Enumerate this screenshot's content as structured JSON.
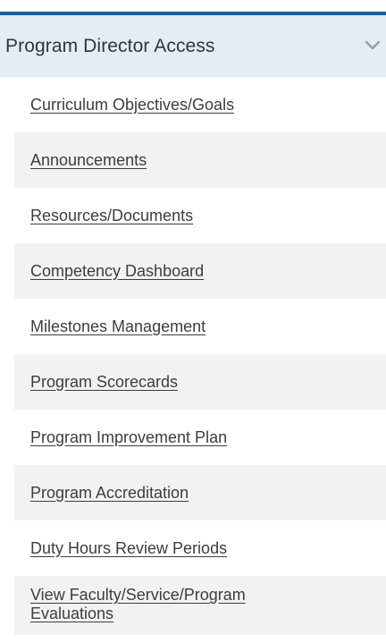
{
  "section": {
    "title": "Program Director Access",
    "toggle_icon": "chevron-down-icon",
    "colors": {
      "accent_bar": "#1f5f95",
      "header_background": "#e4ecf4",
      "stripe": "#f2f2f2"
    }
  },
  "menu": {
    "items": [
      {
        "label": "Curriculum Objectives/Goals"
      },
      {
        "label": "Announcements"
      },
      {
        "label": "Resources/Documents"
      },
      {
        "label": "Competency Dashboard"
      },
      {
        "label": "Milestones Management"
      },
      {
        "label": "Program Scorecards"
      },
      {
        "label": "Program Improvement Plan"
      },
      {
        "label": "Program Accreditation"
      },
      {
        "label": "Duty Hours Review Periods"
      },
      {
        "label": "View Faculty/Service/Program Evaluations"
      }
    ]
  }
}
